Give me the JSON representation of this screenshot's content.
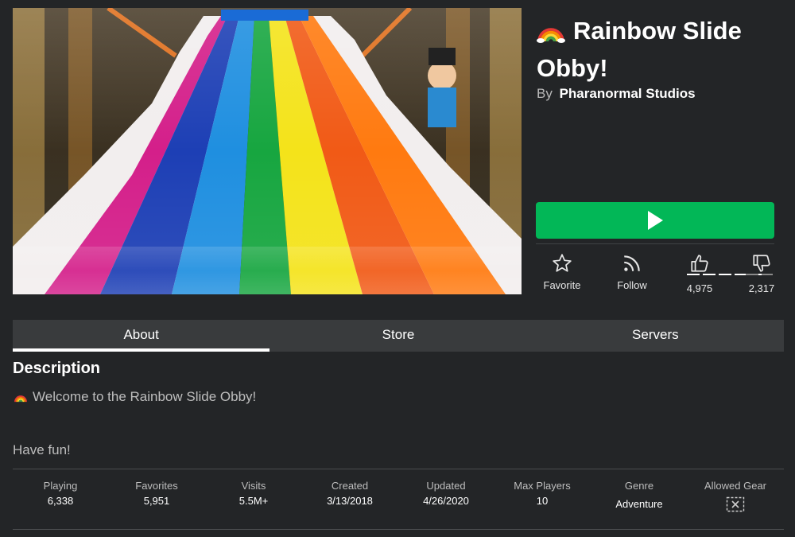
{
  "game": {
    "title": "Rainbow Slide Obby!",
    "by_label": "By",
    "creator": "Pharanormal Studios",
    "thumbnail_icon": "rainbow-slide-image"
  },
  "play_button": {
    "icon": "play-icon",
    "color": "#02b757"
  },
  "actions": {
    "favorite": {
      "icon": "star-icon",
      "label": "Favorite"
    },
    "follow": {
      "icon": "rss-icon",
      "label": "Follow"
    }
  },
  "votes": {
    "up": "4,975",
    "down": "2,317",
    "up_ratio": 0.682
  },
  "tabs": [
    {
      "label": "About",
      "active": true
    },
    {
      "label": "Store",
      "active": false
    },
    {
      "label": "Servers",
      "active": false
    }
  ],
  "description": {
    "heading": "Description",
    "line1": "Welcome to the Rainbow Slide Obby!",
    "line2": "Have fun!"
  },
  "stats": [
    {
      "label": "Playing",
      "value": "6,338"
    },
    {
      "label": "Favorites",
      "value": "5,951"
    },
    {
      "label": "Visits",
      "value": "5.5M+"
    },
    {
      "label": "Created",
      "value": "3/13/2018"
    },
    {
      "label": "Updated",
      "value": "4/26/2020"
    },
    {
      "label": "Max Players",
      "value": "10"
    },
    {
      "label": "Genre",
      "value": "Adventure"
    },
    {
      "label": "Allowed Gear",
      "icon": "no-gear-icon"
    }
  ],
  "colors": {
    "background": "#232527",
    "tab_bar": "#393b3d",
    "accent_green": "#02b757"
  }
}
